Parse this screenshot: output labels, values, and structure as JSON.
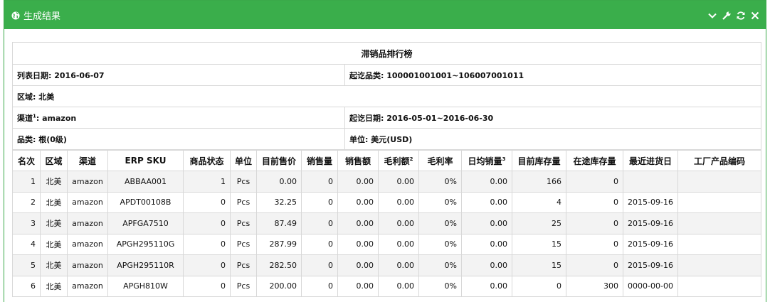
{
  "panel": {
    "title": "生成结果"
  },
  "report": {
    "title": "滞销品排行榜",
    "list_date": "列表日期: 2016-06-07",
    "category_range": "起讫品类: 100001001001~106007001011",
    "region": "区域: 北美",
    "channel_prefix": "渠道",
    "channel_sup": "1",
    "channel_value": ": amazon",
    "date_range": "起讫日期: 2016-05-01~2016-06-30",
    "category": "品类: 根(0级)",
    "unit": "单位: 美元(USD)"
  },
  "columns": {
    "rank": "名次",
    "region": "区域",
    "channel": "渠道",
    "sku": "ERP SKU",
    "status": "商品状态",
    "unit": "单位",
    "price": "目前售价",
    "qty": "销售量",
    "amount": "销售额",
    "profit": "毛利额",
    "profit_sup": "2",
    "margin": "毛利率",
    "daily": "日均销量",
    "daily_sup": "3",
    "stock": "目前库存量",
    "transit": "在途库存量",
    "last_in": "最近进货日",
    "factory": "工厂产品编码"
  },
  "rows": [
    {
      "rank": "1",
      "region": "北美",
      "channel": "amazon",
      "sku": "ABBAA001",
      "status": "1",
      "unit": "Pcs",
      "price": "0.00",
      "qty": "0",
      "amount": "0.00",
      "profit": "0.00",
      "margin": "0%",
      "daily": "0.00",
      "stock": "166",
      "transit": "0",
      "last_in": "",
      "factory": ""
    },
    {
      "rank": "2",
      "region": "北美",
      "channel": "amazon",
      "sku": "APDT00108B",
      "status": "0",
      "unit": "Pcs",
      "price": "32.25",
      "qty": "0",
      "amount": "0.00",
      "profit": "0.00",
      "margin": "0%",
      "daily": "0.00",
      "stock": "4",
      "transit": "0",
      "last_in": "2015-09-16",
      "factory": ""
    },
    {
      "rank": "3",
      "region": "北美",
      "channel": "amazon",
      "sku": "APFGA7510",
      "status": "0",
      "unit": "Pcs",
      "price": "87.49",
      "qty": "0",
      "amount": "0.00",
      "profit": "0.00",
      "margin": "0%",
      "daily": "0.00",
      "stock": "25",
      "transit": "0",
      "last_in": "2015-09-16",
      "factory": ""
    },
    {
      "rank": "4",
      "region": "北美",
      "channel": "amazon",
      "sku": "APGH295110G",
      "status": "0",
      "unit": "Pcs",
      "price": "287.99",
      "qty": "0",
      "amount": "0.00",
      "profit": "0.00",
      "margin": "0%",
      "daily": "0.00",
      "stock": "15",
      "transit": "0",
      "last_in": "2015-09-16",
      "factory": ""
    },
    {
      "rank": "5",
      "region": "北美",
      "channel": "amazon",
      "sku": "APGH295110R",
      "status": "0",
      "unit": "Pcs",
      "price": "282.50",
      "qty": "0",
      "amount": "0.00",
      "profit": "0.00",
      "margin": "0%",
      "daily": "0.00",
      "stock": "15",
      "transit": "0",
      "last_in": "2015-09-16",
      "factory": ""
    },
    {
      "rank": "6",
      "region": "北美",
      "channel": "amazon",
      "sku": "APGH810W",
      "status": "0",
      "unit": "Pcs",
      "price": "200.00",
      "qty": "0",
      "amount": "0.00",
      "profit": "0.00",
      "margin": "0%",
      "daily": "0.00",
      "stock": "0",
      "transit": "300",
      "last_in": "0000-00-00",
      "factory": ""
    }
  ]
}
